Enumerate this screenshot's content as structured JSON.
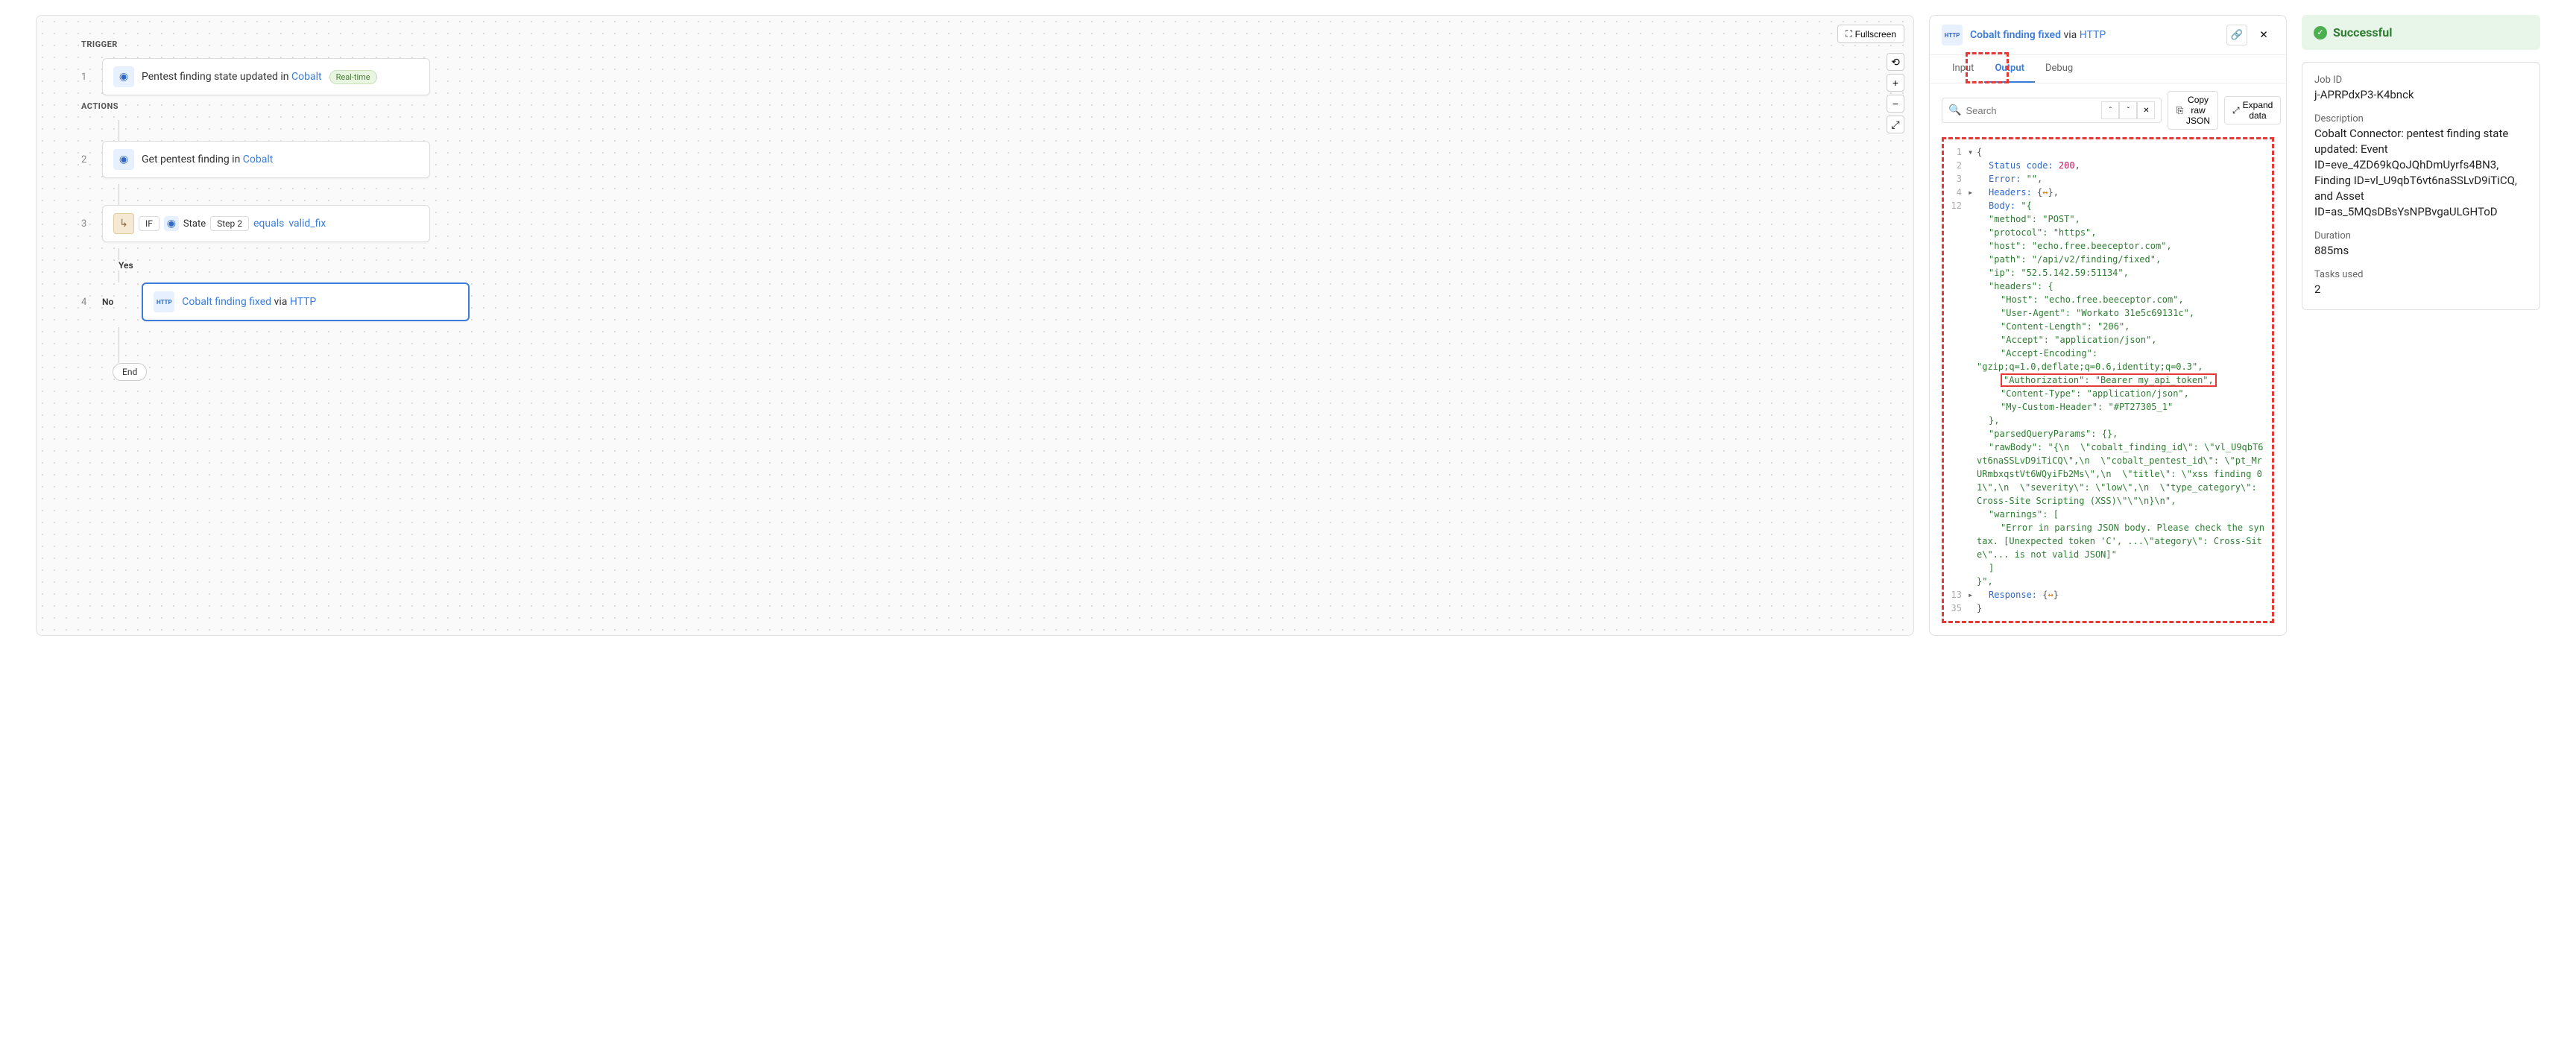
{
  "left": {
    "fullscreen": "Fullscreen",
    "trigger_label": "TRIGGER",
    "actions_label": "ACTIONS",
    "step1": {
      "num": "1",
      "prefix": "Pentest finding state updated in ",
      "link": "Cobalt",
      "badge": "Real-time"
    },
    "step2": {
      "num": "2",
      "prefix": "Get pentest finding in ",
      "link": "Cobalt"
    },
    "step3": {
      "num": "3",
      "if": "IF",
      "state": "State",
      "step": "Step 2",
      "equals": "equals",
      "valid": "valid_fix"
    },
    "yes": "Yes",
    "no": "No",
    "step4": {
      "num": "4",
      "title": "Cobalt finding fixed",
      "via": " via ",
      "http": "HTTP"
    },
    "end": "End"
  },
  "mid": {
    "title": "Cobalt finding fixed",
    "via": " via ",
    "http": "HTTP",
    "tabs": {
      "input": "Input",
      "output": "Output",
      "debug": "Debug"
    },
    "search_placeholder": "Search",
    "copy": "Copy raw JSON",
    "expand": "Expand data",
    "code": {
      "l1": "{",
      "l2": "Status code: 200,",
      "l3": "Error: \"\",",
      "l4_key": "Headers:",
      "l4_val": " {↔},",
      "l12_a": "Body: ",
      "l12_b": "\"{",
      "method": "\"method\": \"POST\",",
      "protocol": "\"protocol\": \"https\",",
      "host": "\"host\": \"echo.free.beeceptor.com\",",
      "path": "\"path\": \"/api/v2/finding/fixed\",",
      "ip": "\"ip\": \"52.5.142.59:51134\",",
      "headers_open": "\"headers\": {",
      "h_host": "\"Host\": \"echo.free.beeceptor.com\",",
      "h_ua": "\"User-Agent\": \"Workato 31e5c69131c\",",
      "h_cl": "\"Content-Length\": \"206\",",
      "h_accept": "\"Accept\": \"application/json\",",
      "h_ae_k": "\"Accept-Encoding\":",
      "h_ae_v": "\"gzip;q=1.0,deflate;q=0.6,identity;q=0.3\",",
      "h_auth": "\"Authorization\": \"Bearer my_api_token\",",
      "h_ct": "\"Content-Type\": \"application/json\",",
      "h_custom": "\"My-Custom-Header\": \"#PT27305_1\"",
      "headers_close": "},",
      "pqp": "\"parsedQueryParams\": {},",
      "raw_a": "\"rawBody\": \"{\\n  \\\"cobalt_finding_id\\\": \\\"vl_U9qbT6vt6naSSLvD9iTiCQ\\\",\\n  \\\"cobalt_pentest_id\\\": \\\"pt_MrURmbxqstVt6WQyiFb2Ms\\\",\\n  \\\"title\\\": \\\"xss finding 01\\\",\\n  \\\"severity\\\": \\\"low\\\",\\n  \\\"type_category\\\": Cross-Site Scripting (XSS)\\\"\\\"\\n}\\n\",",
      "warn_open": "\"warnings\": [",
      "warn_body": "\"Error in parsing JSON body. Please check the syntax. [Unexpected token 'C', ...\\\"ategory\\\": Cross-Site\\\"... is not valid JSON]\"",
      "warn_close": "]",
      "body_close": "}\",",
      "l13_key": "Response:",
      "l13_val": " {↔}",
      "l35": "}"
    }
  },
  "right": {
    "status": "Successful",
    "jobid_label": "Job ID",
    "jobid": "j-APRPdxP3-K4bnck",
    "desc_label": "Description",
    "desc": "Cobalt Connector: pentest finding state updated: Event ID=eve_4ZD69kQoJQhDmUyrfs4BN3, Finding ID=vl_U9qbT6vt6naSSLvD9iTiCQ, and Asset ID=as_5MQsDBsYsNPBvgaULGHToD",
    "dur_label": "Duration",
    "dur": "885ms",
    "tasks_label": "Tasks used",
    "tasks": "2"
  }
}
